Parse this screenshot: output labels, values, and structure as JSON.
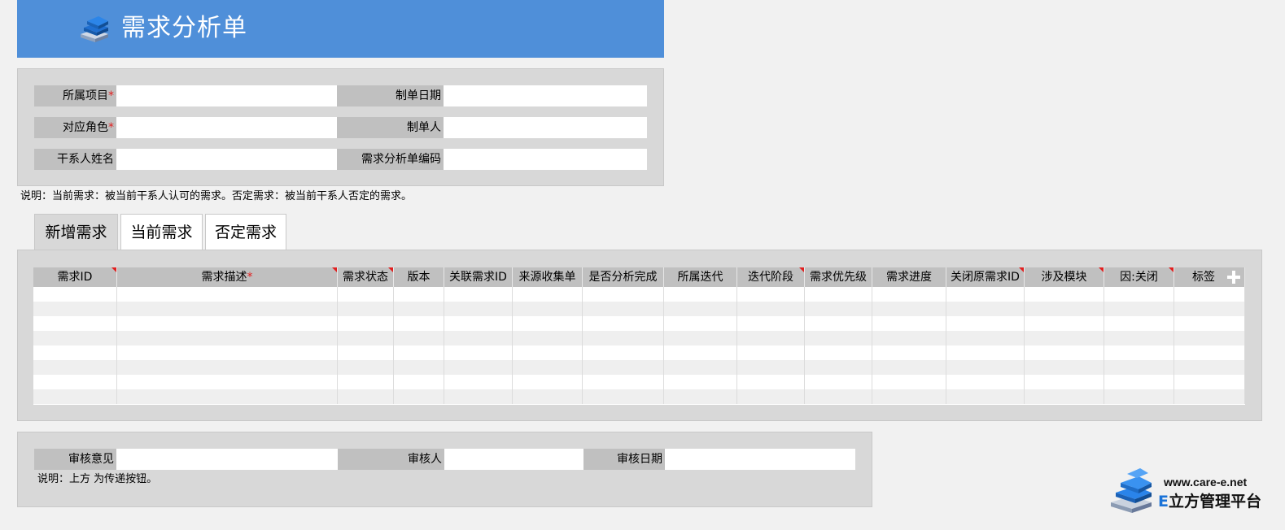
{
  "page": {
    "title": "需求分析单"
  },
  "form": {
    "project_label": "所属项目",
    "role_label": "对应角色",
    "stakeholder_label": "干系人姓名",
    "date_label": "制单日期",
    "creator_label": "制单人",
    "code_label": "需求分析单编码",
    "required_mark": "*",
    "project_value": "",
    "role_value": "",
    "stakeholder_value": "",
    "date_value": "",
    "creator_value": "",
    "code_value": ""
  },
  "note1": "说明：当前需求：被当前干系人认可的需求。否定需求：被当前干系人否定的需求。",
  "tabs": [
    {
      "label": "新增需求",
      "active": true
    },
    {
      "label": "当前需求",
      "active": false
    },
    {
      "label": "否定需求",
      "active": false
    }
  ],
  "grid": {
    "columns": [
      {
        "label": "需求ID",
        "flag": true,
        "required": false
      },
      {
        "label": "需求描述",
        "flag": true,
        "required": true
      },
      {
        "label": "需求状态",
        "flag": true,
        "required": false
      },
      {
        "label": "版本",
        "flag": false,
        "required": false
      },
      {
        "label": "关联需求ID",
        "flag": false,
        "required": false
      },
      {
        "label": "来源收集单",
        "flag": false,
        "required": false
      },
      {
        "label": "是否分析完成",
        "flag": false,
        "required": false
      },
      {
        "label": "所属迭代",
        "flag": false,
        "required": false
      },
      {
        "label": "迭代阶段",
        "flag": true,
        "required": false
      },
      {
        "label": "需求优先级",
        "flag": false,
        "required": false
      },
      {
        "label": "需求进度",
        "flag": false,
        "required": false
      },
      {
        "label": "关闭原需求ID",
        "flag": true,
        "required": false
      },
      {
        "label": "涉及模块",
        "flag": true,
        "required": false
      },
      {
        "label": "因:关闭",
        "flag": true,
        "required": false
      },
      {
        "label": "标签",
        "flag": false,
        "required": false
      }
    ],
    "row_count": 8
  },
  "review": {
    "opinion_label": "审核意见",
    "reviewer_label": "审核人",
    "date_label": "审核日期",
    "opinion_value": "",
    "reviewer_value": "",
    "date_value": ""
  },
  "note2": "说明：上方      为传递按钮。",
  "brand": {
    "url": "www.care-e.net",
    "letter": "E",
    "name": "立方管理平台"
  },
  "colors": {
    "title_bar": "#4f8fd9",
    "panel": "#d8d8d8",
    "label_bg": "#c0c0c0",
    "required": "#e02020",
    "alt_row": "#efefef",
    "brand_blue": "#1a73d8"
  },
  "icons": {
    "title_logo": "cube-stack-icon",
    "add_column": "plus-icon",
    "brand_logo": "cube-stack-icon"
  }
}
